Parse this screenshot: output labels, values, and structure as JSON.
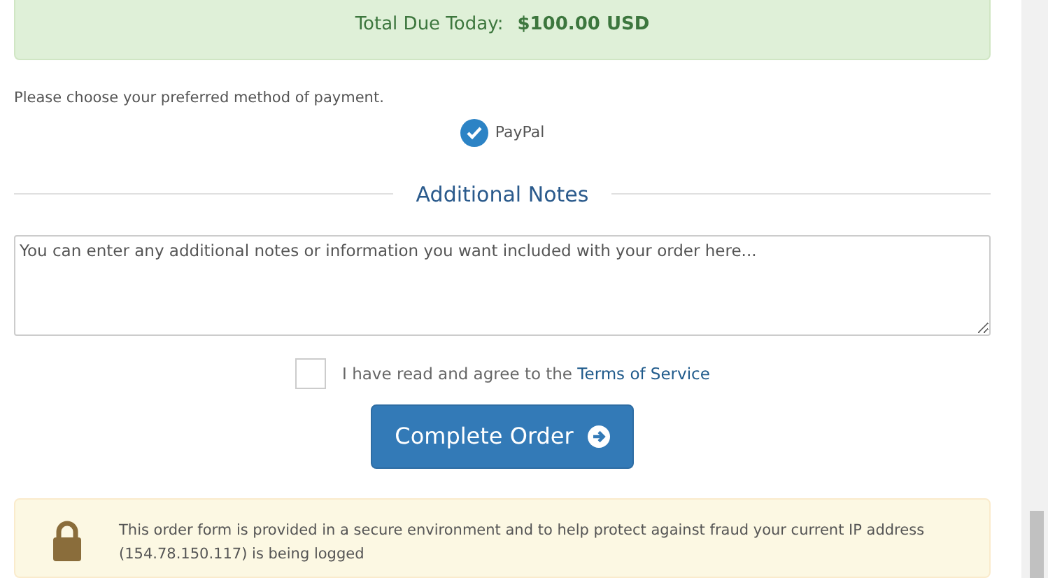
{
  "total": {
    "label": "Total Due Today:",
    "amount": "$100.00 USD"
  },
  "payment": {
    "prompt": "Please choose your preferred method of payment.",
    "methods": [
      {
        "label": "PayPal",
        "selected": true
      }
    ]
  },
  "notes": {
    "heading": "Additional Notes",
    "placeholder": "You can enter any additional notes or information you want included with your order here..."
  },
  "terms": {
    "checked": false,
    "text": "I have read and agree to the ",
    "link": "Terms of Service"
  },
  "submit": {
    "label": "Complete Order"
  },
  "security": {
    "text": "This order form is provided in a secure environment and to help protect against fraud your current IP address (154.78.150.117) is being logged"
  }
}
